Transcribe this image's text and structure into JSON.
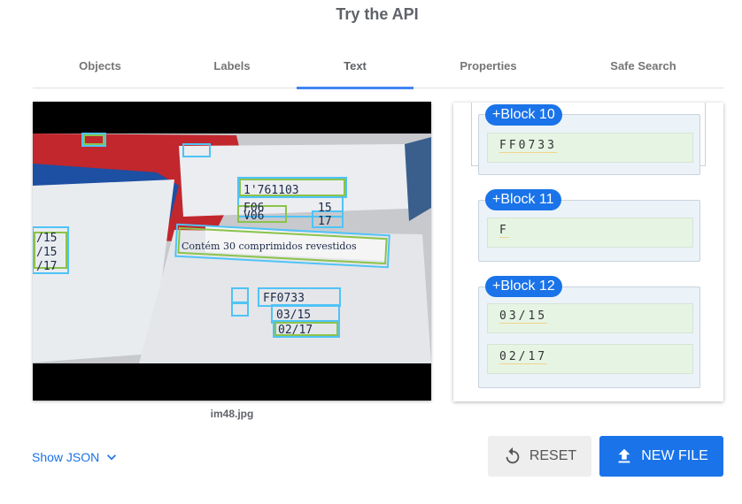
{
  "page": {
    "title": "Try the API"
  },
  "tabs": [
    {
      "label": "Objects"
    },
    {
      "label": "Labels"
    },
    {
      "label": "Text",
      "active": true
    },
    {
      "label": "Properties"
    },
    {
      "label": "Safe Search"
    }
  ],
  "image": {
    "filename": "im48.jpg",
    "box_texts": [
      "1'761103",
      "F06",
      "V06",
      "15",
      "17",
      "Contém 30 comprimidos revestidos",
      "FF0733",
      "03/15",
      "02/17",
      "/15",
      "/15",
      "/17"
    ]
  },
  "blocks": [
    {
      "label": "+Block 10",
      "lines": [
        "FF0733"
      ]
    },
    {
      "label": "+Block 11",
      "lines": [
        "F"
      ]
    },
    {
      "label": "+Block 12",
      "lines": [
        "03/15",
        "02/17"
      ]
    }
  ],
  "footer": {
    "show_json": "Show JSON",
    "reset": "RESET",
    "new_file": "NEW FILE"
  },
  "colors": {
    "accent": "#1a73e8",
    "block_bg": "#ebf3f8",
    "line_bg": "#e6f4e4",
    "box_outer": "#4fc3f7",
    "box_inner": "#8bc34a"
  }
}
